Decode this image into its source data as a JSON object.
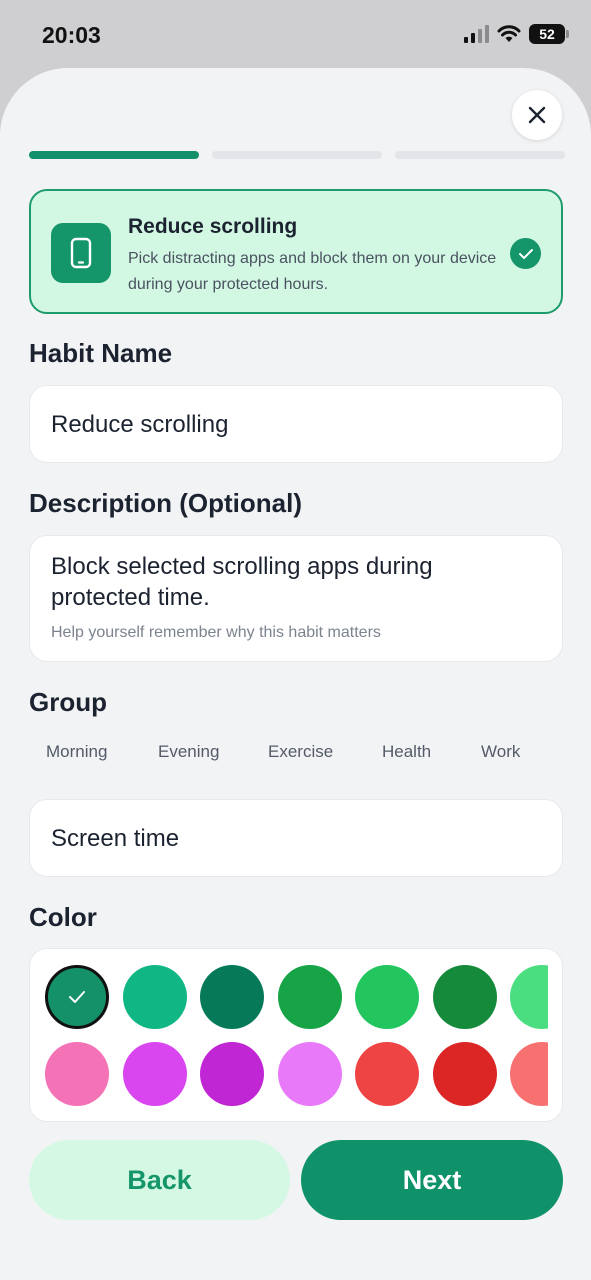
{
  "status_bar": {
    "time": "20:03",
    "battery": "52",
    "icons": [
      "signal-icon",
      "wifi-icon",
      "battery-icon"
    ]
  },
  "header": {
    "close_icon": "close-icon",
    "progress_steps": 3,
    "progress_current": 1
  },
  "template_card": {
    "icon": "phone-icon",
    "title": "Reduce scrolling",
    "description": "Pick distracting apps and block them on your device during your protected hours.",
    "selected": true
  },
  "habit_name": {
    "label": "Habit Name",
    "value": "Reduce scrolling"
  },
  "description": {
    "label": "Description (Optional)",
    "value": "Block selected scrolling apps during protected time.",
    "hint": "Help yourself remember why this habit matters"
  },
  "group": {
    "label": "Group",
    "chips": [
      "Morning",
      "Evening",
      "Exercise",
      "Health",
      "Work"
    ],
    "value": "Screen time"
  },
  "color": {
    "label": "Color",
    "selected_index": 0,
    "swatches": [
      "#149168",
      "#10b683",
      "#067a58",
      "#17a446",
      "#22c55e",
      "#168a3b",
      "#4ade80",
      "#f472b6",
      "#d946ef",
      "#c026d3",
      "#e879f9",
      "#ef4444",
      "#dc2626",
      "#f87171"
    ]
  },
  "actions": {
    "back_label": "Back",
    "next_label": "Next",
    "accent": "#0f926a"
  }
}
